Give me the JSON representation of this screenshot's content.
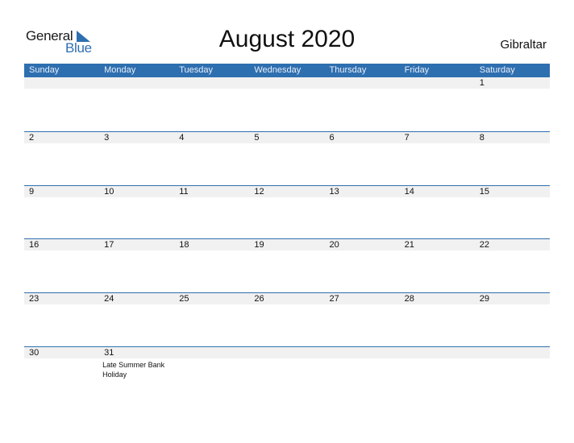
{
  "logo": {
    "word1": "General",
    "word2": "Blue"
  },
  "title": "August 2020",
  "country": "Gibraltar",
  "colors": {
    "accent": "#2e6fb0",
    "date_strip": "#f1f1f1"
  },
  "weekdays": [
    "Sunday",
    "Monday",
    "Tuesday",
    "Wednesday",
    "Thursday",
    "Friday",
    "Saturday"
  ],
  "weeks": [
    {
      "days": [
        "",
        "",
        "",
        "",
        "",
        "",
        "1"
      ],
      "events": [
        "",
        "",
        "",
        "",
        "",
        "",
        ""
      ]
    },
    {
      "days": [
        "2",
        "3",
        "4",
        "5",
        "6",
        "7",
        "8"
      ],
      "events": [
        "",
        "",
        "",
        "",
        "",
        "",
        ""
      ]
    },
    {
      "days": [
        "9",
        "10",
        "11",
        "12",
        "13",
        "14",
        "15"
      ],
      "events": [
        "",
        "",
        "",
        "",
        "",
        "",
        ""
      ]
    },
    {
      "days": [
        "16",
        "17",
        "18",
        "19",
        "20",
        "21",
        "22"
      ],
      "events": [
        "",
        "",
        "",
        "",
        "",
        "",
        ""
      ]
    },
    {
      "days": [
        "23",
        "24",
        "25",
        "26",
        "27",
        "28",
        "29"
      ],
      "events": [
        "",
        "",
        "",
        "",
        "",
        "",
        ""
      ]
    },
    {
      "days": [
        "30",
        "31",
        "",
        "",
        "",
        "",
        ""
      ],
      "events": [
        "",
        "Late Summer Bank Holiday",
        "",
        "",
        "",
        "",
        ""
      ]
    }
  ]
}
